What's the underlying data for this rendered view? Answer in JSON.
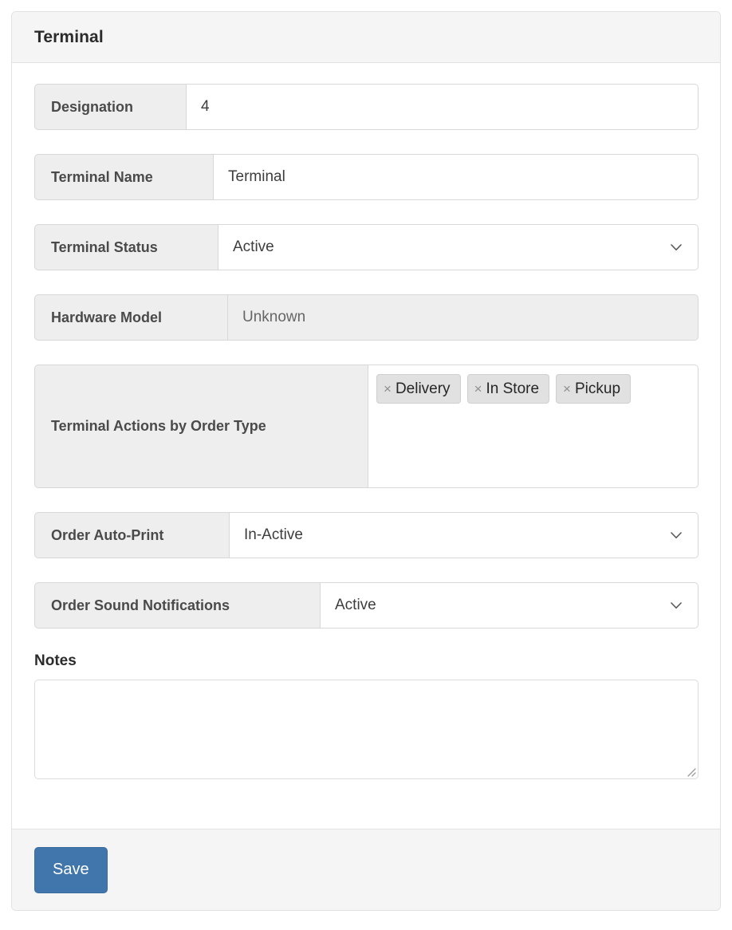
{
  "panel": {
    "title": "Terminal"
  },
  "fields": [
    {
      "label": "Designation",
      "value": "4",
      "type": "text",
      "addon_width": 190
    },
    {
      "label": "Terminal Name",
      "value": "Terminal",
      "type": "text",
      "addon_width": 224
    },
    {
      "label": "Terminal Status",
      "value": "Active",
      "type": "select",
      "addon_width": 230
    },
    {
      "label": "Hardware Model",
      "value": "Unknown",
      "type": "disabled",
      "addon_width": 242
    }
  ],
  "tag_field": {
    "label": "Terminal Actions by Order Type",
    "addon_width": 418,
    "remove_icon": "×",
    "tags": [
      "Delivery",
      "In Store",
      "Pickup"
    ]
  },
  "fields_lower": [
    {
      "label": "Order Auto-Print",
      "value": "In-Active",
      "type": "select",
      "addon_width": 244
    },
    {
      "label": "Order Sound Notifications",
      "value": "Active",
      "type": "select",
      "addon_width": 358
    }
  ],
  "notes": {
    "label": "Notes",
    "value": "",
    "placeholder": ""
  },
  "footer": {
    "save_label": "Save"
  },
  "colors": {
    "accent": "#4076ac",
    "addon_bg": "#eeeeee",
    "header_bg": "#f5f5f5",
    "border": "#d8d8d8",
    "tag_bg": "#e1e1e1"
  }
}
